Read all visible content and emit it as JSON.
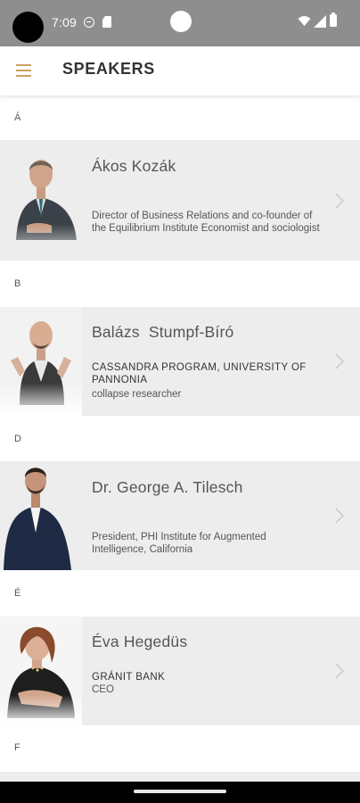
{
  "status_bar": {
    "time": "7:09"
  },
  "header": {
    "title": "SPEAKERS"
  },
  "sections": [
    {
      "letter": "Á",
      "speakers": [
        {
          "name": "Ákos Kozák",
          "organization": "",
          "description": "Director of Business Relations and co-founder of the Equilibrium Institute Economist and sociologist"
        }
      ]
    },
    {
      "letter": "B",
      "speakers": [
        {
          "name": "Balázs  Stumpf-Bíró",
          "organization": "CASSANDRA PROGRAM, UNIVERSITY OF PANNONIA",
          "description": "collapse researcher"
        }
      ]
    },
    {
      "letter": "D",
      "speakers": [
        {
          "name": "Dr. George A. Tilesch",
          "organization": "",
          "description": "President, PHI Institute for Augmented Intelligence, California"
        }
      ]
    },
    {
      "letter": "É",
      "speakers": [
        {
          "name": "Éva Hegedüs",
          "organization": "GRÁNIT BANK",
          "description": "CEO"
        }
      ]
    },
    {
      "letter": "F",
      "speakers": []
    }
  ],
  "colors": {
    "accent": "#c9a063",
    "row_background": "#ededed",
    "status_bar": "#8e8e8e"
  },
  "icons": {
    "menu": "hamburger-menu-icon",
    "chevron": "chevron-right-icon"
  }
}
